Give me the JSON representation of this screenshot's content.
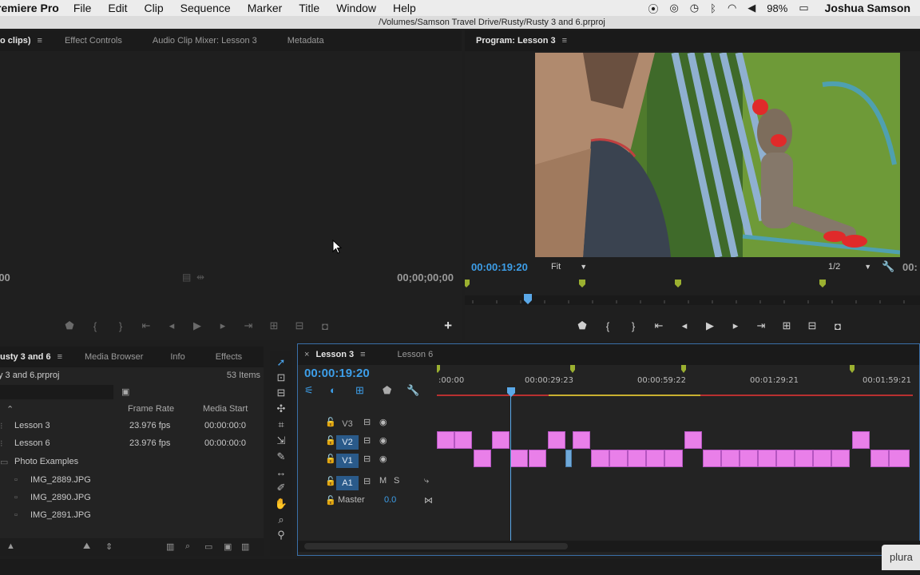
{
  "menubar": {
    "app_name": "remiere Pro",
    "items": [
      "File",
      "Edit",
      "Clip",
      "Sequence",
      "Marker",
      "Title",
      "Window",
      "Help"
    ],
    "battery": "98%",
    "user": "Joshua Samson"
  },
  "path": "/Volumes/Samson Travel Drive/Rusty/Rusty 3 and 6.prproj",
  "source_panel": {
    "tabs": [
      {
        "label": "o clips)",
        "active": true
      },
      {
        "label": "Effect Controls"
      },
      {
        "label": "Audio Clip Mixer: Lesson 3"
      },
      {
        "label": "Metadata"
      }
    ],
    "timecode_left": ";00",
    "timecode_right": "00;00;00;00"
  },
  "program_panel": {
    "tab": "Program: Lesson 3",
    "timecode": "00:00:19:20",
    "fit": "Fit",
    "resolution": "1/2",
    "timecode_right": "00:"
  },
  "project_panel": {
    "tabs": [
      {
        "label": "usty 3 and 6",
        "active": true
      },
      {
        "label": "Media Browser"
      },
      {
        "label": "Info"
      },
      {
        "label": "Effects"
      }
    ],
    "project_file": "y 3 and 6.prproj",
    "item_count": "53 Items",
    "columns": [
      "Frame Rate",
      "Media Start"
    ],
    "rows": [
      {
        "name": "Lesson 3",
        "frame_rate": "23.976 fps",
        "media_start": "00:00:00:0"
      },
      {
        "name": "Lesson 6",
        "frame_rate": "23.976 fps",
        "media_start": "00:00:00:0"
      },
      {
        "name": "Photo Examples",
        "frame_rate": "",
        "media_start": ""
      },
      {
        "name": "IMG_2889.JPG",
        "frame_rate": "",
        "media_start": ""
      },
      {
        "name": "IMG_2890.JPG",
        "frame_rate": "",
        "media_start": ""
      },
      {
        "name": "IMG_2891.JPG",
        "frame_rate": "",
        "media_start": ""
      }
    ]
  },
  "timeline": {
    "tabs": [
      {
        "label": "Lesson 3",
        "active": true
      },
      {
        "label": "Lesson 6"
      }
    ],
    "timecode": "00:00:19:20",
    "ruler_labels": [
      ":00:00",
      "00:00:29:23",
      "00:00:59:22",
      "00:01:29:21",
      "00:01:59:21"
    ],
    "tracks": [
      {
        "name": "V3",
        "active": false
      },
      {
        "name": "V2",
        "active": true
      },
      {
        "name": "V1",
        "active": true
      },
      {
        "name": "A1",
        "active": true
      }
    ],
    "master_label": "Master",
    "master_value": "0.0",
    "mute": "M",
    "solo": "S"
  },
  "watermark": "plura"
}
